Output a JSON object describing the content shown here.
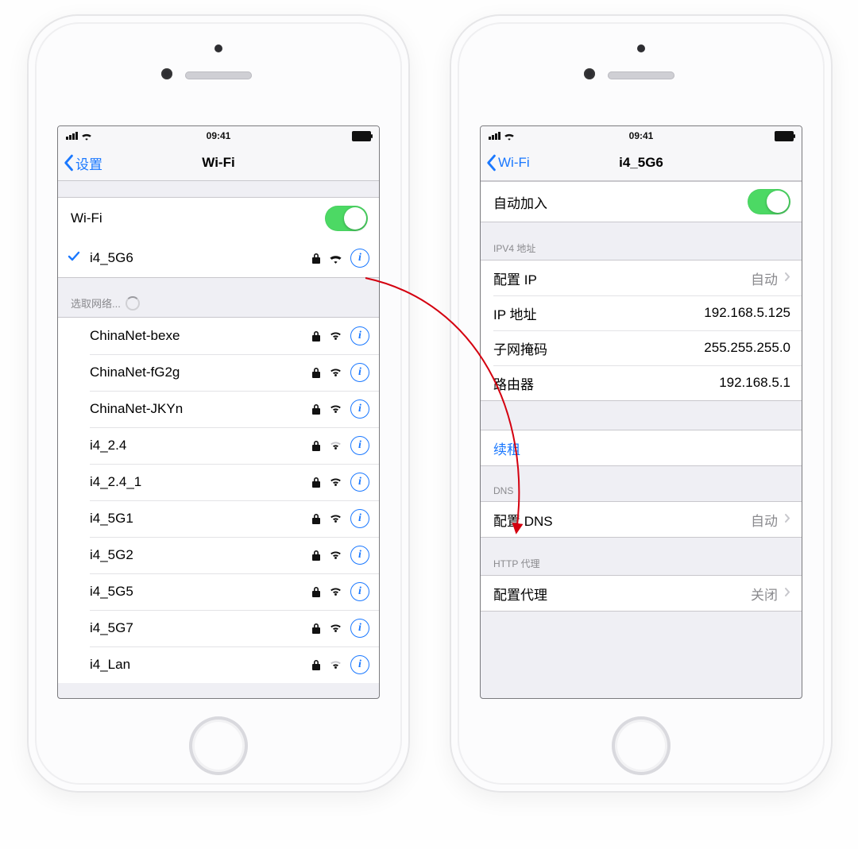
{
  "status": {
    "time": "09:41"
  },
  "left": {
    "back_label": "设置",
    "title": "Wi-Fi",
    "wifi_row_label": "Wi-Fi",
    "connected": {
      "name": "i4_5G6",
      "locked": true
    },
    "choose_label": "选取网络...",
    "networks": [
      {
        "name": "ChinaNet-bexe",
        "locked": true,
        "strength": 3
      },
      {
        "name": "ChinaNet-fG2g",
        "locked": true,
        "strength": 3
      },
      {
        "name": "ChinaNet-JKYn",
        "locked": true,
        "strength": 3
      },
      {
        "name": "i4_2.4",
        "locked": true,
        "strength": 2
      },
      {
        "name": "i4_2.4_1",
        "locked": true,
        "strength": 3
      },
      {
        "name": "i4_5G1",
        "locked": true,
        "strength": 3
      },
      {
        "name": "i4_5G2",
        "locked": true,
        "strength": 3
      },
      {
        "name": "i4_5G5",
        "locked": true,
        "strength": 3
      },
      {
        "name": "i4_5G7",
        "locked": true,
        "strength": 3
      },
      {
        "name": "i4_Lan",
        "locked": true,
        "strength": 2
      }
    ]
  },
  "right": {
    "back_label": "Wi-Fi",
    "title": "i4_5G6",
    "auto_join_label": "自动加入",
    "sections": {
      "ipv4": {
        "header": "IPV4 地址",
        "configure_ip_label": "配置 IP",
        "configure_ip_value": "自动",
        "ip_label": "IP 地址",
        "ip_value": "192.168.5.125",
        "mask_label": "子网掩码",
        "mask_value": "255.255.255.0",
        "router_label": "路由器",
        "router_value": "192.168.5.1"
      },
      "renew_label": "续租",
      "dns": {
        "header": "DNS",
        "configure_label": "配置 DNS",
        "configure_value": "自动"
      },
      "proxy": {
        "header": "HTTP 代理",
        "configure_label": "配置代理",
        "configure_value": "关闭"
      }
    }
  }
}
